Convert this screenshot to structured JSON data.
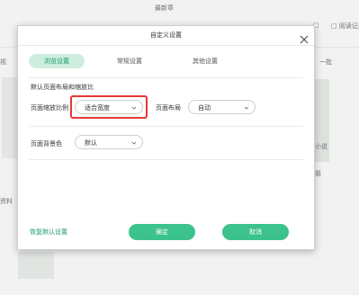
{
  "background": {
    "top_center_text": "最新章",
    "top_right_text_1": "□",
    "top_right_text_2": "□ 阅读记录",
    "left_fragment_1": "视",
    "left_fragment_2": "资料",
    "right_fragment_1": "一批",
    "right_fragment_2": "小说",
    "right_fragment_3": "姐"
  },
  "dialog": {
    "title": "自定义设置",
    "tabs": [
      {
        "label": "浏览设置",
        "active": true
      },
      {
        "label": "常规设置",
        "active": false
      },
      {
        "label": "其他设置",
        "active": false
      }
    ],
    "section_title": "默认页面布局和缩放比",
    "zoom_label": "页面缩放比例",
    "zoom_value": "适合宽度",
    "layout_label": "页面布局",
    "layout_value": "自动",
    "bgcolor_label": "页面背景色",
    "bgcolor_value": "默认",
    "restore_link": "恢复默认设置",
    "ok_button": "确定",
    "cancel_button": "取消"
  },
  "colors": {
    "accent": "#3cc28d",
    "accent_light": "#cdeede",
    "highlight": "#e53935"
  }
}
